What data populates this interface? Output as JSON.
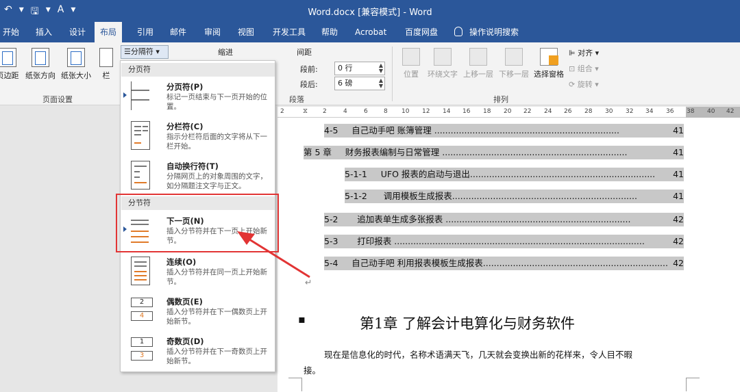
{
  "titlebar": {
    "title": "Word.docx [兼容模式]  -  Word",
    "qat": [
      "↶",
      "▾",
      "🖫",
      "▾",
      "A",
      "▾"
    ]
  },
  "tabs": [
    "开始",
    "插入",
    "设计",
    "布局",
    "引用",
    "邮件",
    "审阅",
    "视图",
    "开发工具",
    "帮助",
    "Acrobat",
    "百度网盘"
  ],
  "tell_me": "操作说明搜索",
  "ribbon": {
    "page_setup": {
      "margins": "页边距",
      "orientation": "纸张方向",
      "size": "纸张大小",
      "columns": "栏",
      "breaks": "分隔符",
      "group": "页面设置"
    },
    "indent_label": "缩进",
    "spacing": {
      "label": "间距",
      "before_label": "段前:",
      "before_value": "0 行",
      "after_label": "段后:",
      "after_value": "6 磅"
    },
    "paragraph_group": "段落",
    "arrange": {
      "position": "位置",
      "wrap": "环绕文字",
      "forward": "上移一层",
      "backward": "下移一层",
      "selection": "选择窗格",
      "align": "对齐",
      "group_obj": "组合",
      "rotate": "旋转",
      "group": "排列"
    }
  },
  "ruler_ticks": [
    "2",
    "2",
    "4",
    "6",
    "8",
    "10",
    "12",
    "14",
    "16",
    "18",
    "20",
    "22",
    "24",
    "26",
    "28",
    "30",
    "32",
    "34",
    "36",
    "38",
    "40",
    "42"
  ],
  "dropdown": {
    "header1": "分页符",
    "header2": "分节符",
    "items": [
      {
        "title": "分页符(P)",
        "desc": "标记一页结束与下一页开始的位置。"
      },
      {
        "title": "分栏符(C)",
        "desc": "指示分栏符后面的文字将从下一栏开始。"
      },
      {
        "title": "自动换行符(T)",
        "desc": "分隔网页上的对象周围的文字，如分隔题注文字与正文。"
      },
      {
        "title": "下一页(N)",
        "desc": "插入分节符并在下一页上开始新节。"
      },
      {
        "title": "连续(O)",
        "desc": "插入分节符并在同一页上开始新节。"
      },
      {
        "title": "偶数页(E)",
        "desc": "插入分节符并在下一偶数页上开始新节。"
      },
      {
        "title": "奇数页(D)",
        "desc": "插入分节符并在下一奇数页上开始新节。"
      }
    ]
  },
  "document": {
    "toc": [
      {
        "num": "4-5",
        "text": "自己动手吧   账簿管理",
        "page": "41"
      },
      {
        "num": "第 5 章",
        "text": "财务报表编制与日常管理",
        "page": "41"
      },
      {
        "num": "5-1-1",
        "text": "UFO 报表的启动与退出",
        "page": "41"
      },
      {
        "num": "5-1-2",
        "text": "调用模板生成报表",
        "page": "41"
      },
      {
        "num": "5-2",
        "text": "追加表单生成多张报表",
        "page": "42"
      },
      {
        "num": "5-3",
        "text": "打印报表",
        "page": "42"
      },
      {
        "num": "5-4",
        "text": "自己动手吧   利用报表模板生成报表",
        "page": "42"
      }
    ],
    "chapter_title": "第1章   了解会计电算化与财务软件",
    "body_line1": "现在是信息化的时代，名称术语满天飞，几天就会变换出新的花样来，令人目不暇",
    "body_line2": "接。",
    "para_mark": "↵"
  }
}
